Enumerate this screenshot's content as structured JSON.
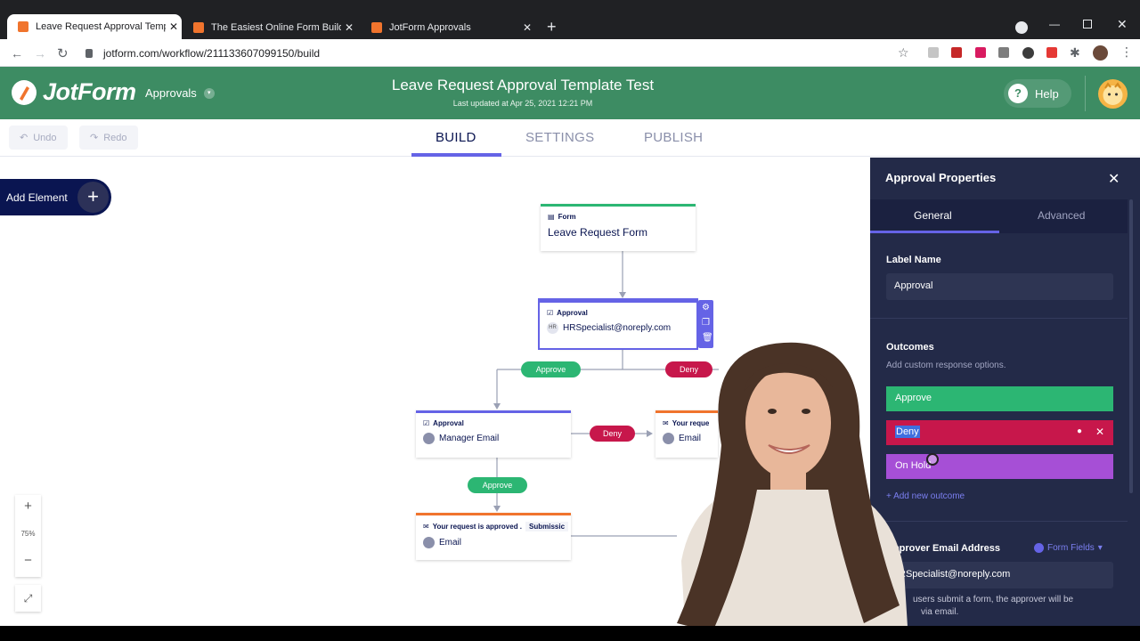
{
  "browser": {
    "tabs": [
      {
        "label": "Leave Request Approval Templat"
      },
      {
        "label": "The Easiest Online Form Builder"
      },
      {
        "label": "JotForm Approvals"
      }
    ],
    "url": "jotform.com/workflow/211133607099150/build"
  },
  "header": {
    "logo": "JotForm",
    "product": "Approvals",
    "title": "Leave Request Approval Template Test",
    "subtitle": "Last updated at Apr 25, 2021 12:21 PM",
    "help": "Help"
  },
  "toolbar": {
    "undo": "Undo",
    "redo": "Redo",
    "tabs": [
      "BUILD",
      "SETTINGS",
      "PUBLISH"
    ]
  },
  "canvas": {
    "add_element": "Add Element",
    "zoom": "75%",
    "nodes": {
      "form": {
        "type": "Form",
        "label": "Leave Request Form"
      },
      "approval1": {
        "type": "Approval",
        "avatar": "HR",
        "label": "HRSpecialist@noreply.com"
      },
      "approval2": {
        "type": "Approval",
        "label": "Manager Email"
      },
      "yourreq": {
        "type": "Your reque",
        "label": "Email"
      },
      "approved": {
        "type": "Your request is approved .",
        "extra": "Submissic",
        "label": "Email"
      }
    },
    "pills": {
      "approve1": "Approve",
      "deny1": "Deny",
      "deny2": "Deny",
      "approve2": "Approve"
    }
  },
  "panel": {
    "title": "Approval Properties",
    "tabs": [
      "General",
      "Advanced"
    ],
    "label_name": {
      "heading": "Label Name",
      "value": "Approval"
    },
    "outcomes": {
      "heading": "Outcomes",
      "hint": "Add custom response options.",
      "items": [
        "Approve",
        "Deny",
        "On Hold"
      ],
      "add": "+ Add new outcome"
    },
    "approver": {
      "heading": "Approver Email Address",
      "fields_btn": "Form Fields",
      "value": "RSpecialist@noreply.com",
      "note_line1": "users submit a form, the approver will be",
      "note_line2": "via email."
    }
  },
  "colors": {
    "brand_green": "#3d8c63",
    "navy": "#0a1551",
    "approve": "#2cb673",
    "deny": "#c7174b",
    "hold": "#a64fd6",
    "accent": "#6563e6"
  }
}
